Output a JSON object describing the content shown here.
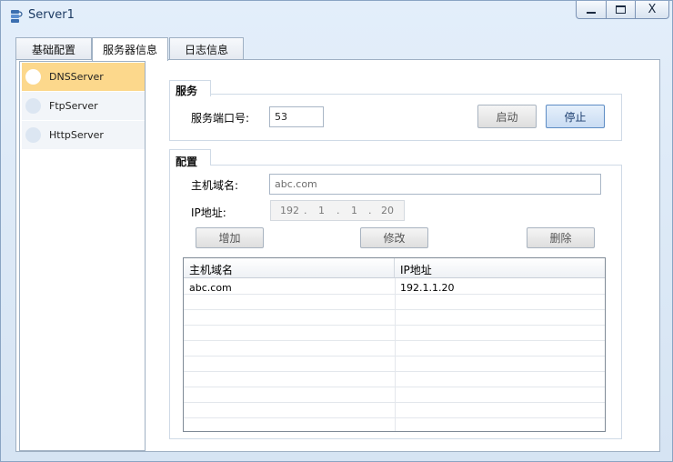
{
  "window": {
    "title": "Server1",
    "controls": {
      "minimize": "minimize",
      "maximize": "maximize",
      "close": "X"
    }
  },
  "tabs": [
    {
      "label": "基础配置",
      "active": false
    },
    {
      "label": "服务器信息",
      "active": true
    },
    {
      "label": "日志信息",
      "active": false
    }
  ],
  "sidebar": {
    "items": [
      {
        "label": "DNSServer",
        "selected": true
      },
      {
        "label": "FtpServer",
        "selected": false
      },
      {
        "label": "HttpServer",
        "selected": false
      }
    ]
  },
  "service": {
    "group_label": "服务",
    "port_label": "服务端口号:",
    "port_value": "53",
    "start_label": "启动",
    "stop_label": "停止"
  },
  "config": {
    "group_label": "配置",
    "host_label": "主机域名:",
    "host_value": "abc.com",
    "ip_label": "IP地址:",
    "ip": [
      "192",
      "1",
      "1",
      "20"
    ],
    "ip_dot": ".",
    "add_label": "增加",
    "edit_label": "修改",
    "delete_label": "删除"
  },
  "table": {
    "columns": [
      "主机域名",
      "IP地址"
    ],
    "rows": [
      [
        "abc.com",
        "192.1.1.20"
      ]
    ]
  },
  "colors": {
    "selected_item": "#fcd88c",
    "window_bg": "#dde9f5",
    "primary_button": "#c9dcf3"
  }
}
